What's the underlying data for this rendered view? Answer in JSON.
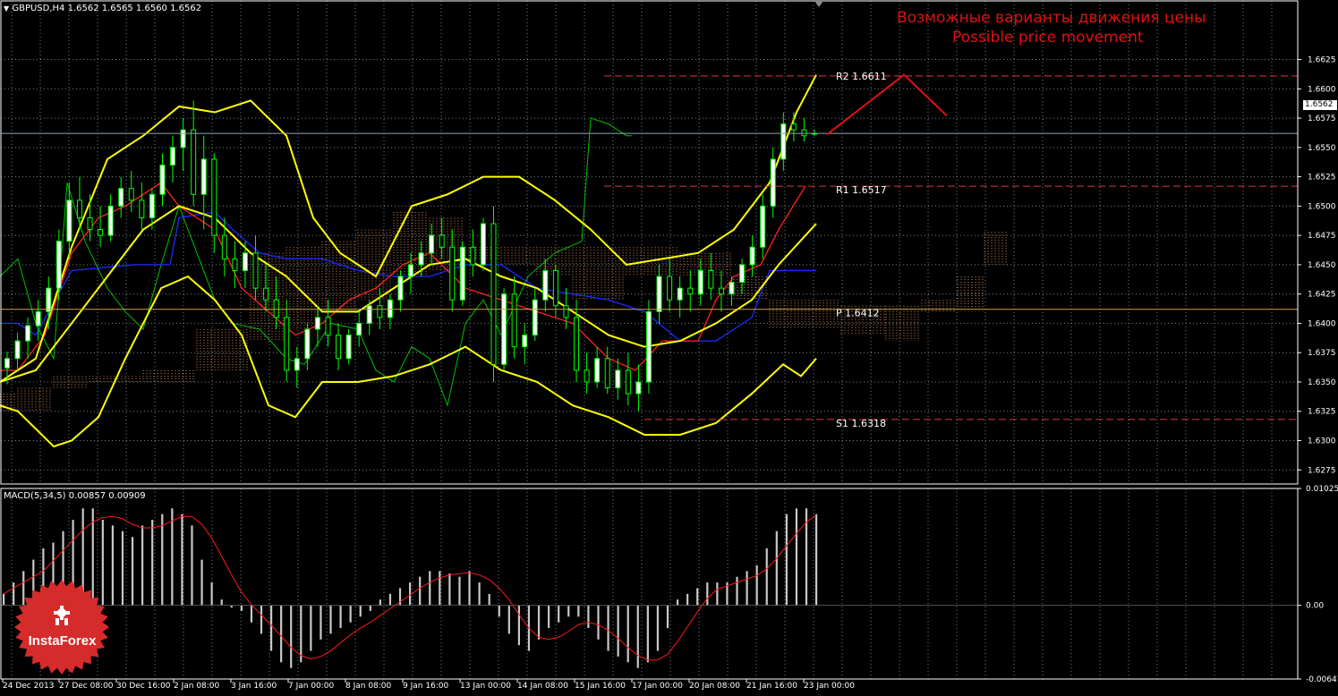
{
  "header": {
    "symbol_text": "GBPUSD,H4  1.6562 1.6565 1.6560 1.6562"
  },
  "annotation": {
    "line1": "Возможные варианты движения цены",
    "line2": "Possible price movement"
  },
  "price_tag": "1.6562",
  "levels": [
    {
      "name": "R2",
      "label": "R2  1.6611",
      "value": 1.6611
    },
    {
      "name": "R1",
      "label": "R1  1.6517",
      "value": 1.6517
    },
    {
      "name": "P",
      "label": "P  1.6412",
      "value": 1.6412
    },
    {
      "name": "S1",
      "label": "S1  1.6318",
      "value": 1.6318
    }
  ],
  "macd_label": "MACD(5,34,5) 0.00857 0.00909",
  "logo_text": "InstaForex",
  "colors": {
    "grid": "#6e7f8f",
    "frame": "#ffffff",
    "bollinger": "#ffff00",
    "ma_red": "#ff2222",
    "ma_blue": "#1a2cff",
    "green": "#00c000",
    "candle_body": "#ffffff",
    "candle_edge": "#00ff00",
    "cloud": "#d88b5a",
    "level_dash": "#d83a3a",
    "arrow": "#e01010",
    "annotation": "#e01010",
    "pivot_line": "#c9a34a",
    "macd_hist": "#c8c8c8",
    "macd_signal": "#ff1a1a",
    "logo": "#d62b2b"
  },
  "chart_data": {
    "type": "candlestick",
    "symbol": "GBPUSD",
    "timeframe": "H4",
    "ohlc_last": {
      "open": 1.6562,
      "high": 1.6565,
      "low": 1.656,
      "close": 1.6562
    },
    "current_price": 1.6562,
    "price_axis": {
      "ylim": [
        1.6263,
        1.6675
      ],
      "ticks": [
        "1.6625",
        "1.6600",
        "1.6575",
        "1.6550",
        "1.6525",
        "1.6500",
        "1.6475",
        "1.6450",
        "1.6425",
        "1.6400",
        "1.6375",
        "1.6350",
        "1.6325",
        "1.6300",
        "1.6275"
      ]
    },
    "time_axis": {
      "ticks": [
        "24 Dec 2013",
        "27 Dec 08:00",
        "30 Dec 16:00",
        "2 Jan 08:00",
        "3 Jan 16:00",
        "7 Jan 00:00",
        "8 Jan 08:00",
        "9 Jan 16:00",
        "13 Jan 00:00",
        "14 Jan 08:00",
        "15 Jan 16:00",
        "17 Jan 00:00",
        "20 Jan 08:00",
        "21 Jan 16:00",
        "23 Jan 00:00"
      ]
    },
    "pivot_levels": {
      "R2": 1.6611,
      "R1": 1.6517,
      "P": 1.6412,
      "S1": 1.6318
    },
    "candles": [
      [
        1.6362,
        1.6376,
        1.6348,
        1.637
      ],
      [
        1.637,
        1.6392,
        1.636,
        1.6385
      ],
      [
        1.6385,
        1.6405,
        1.637,
        1.6398
      ],
      [
        1.6398,
        1.642,
        1.6385,
        1.641
      ],
      [
        1.641,
        1.644,
        1.6395,
        1.643
      ],
      [
        1.643,
        1.648,
        1.642,
        1.647
      ],
      [
        1.647,
        1.652,
        1.6455,
        1.6505
      ],
      [
        1.6505,
        1.6525,
        1.648,
        1.649
      ],
      [
        1.649,
        1.651,
        1.647,
        1.648
      ],
      [
        1.648,
        1.65,
        1.6465,
        1.6475
      ],
      [
        1.6475,
        1.651,
        1.647,
        1.65
      ],
      [
        1.65,
        1.6525,
        1.649,
        1.6515
      ],
      [
        1.6515,
        1.653,
        1.6495,
        1.6505
      ],
      [
        1.6505,
        1.652,
        1.648,
        1.649
      ],
      [
        1.649,
        1.6515,
        1.648,
        1.651
      ],
      [
        1.651,
        1.6545,
        1.65,
        1.6535
      ],
      [
        1.6535,
        1.656,
        1.652,
        1.655
      ],
      [
        1.655,
        1.6575,
        1.653,
        1.6565
      ],
      [
        1.6565,
        1.659,
        1.65,
        1.651
      ],
      [
        1.651,
        1.656,
        1.648,
        1.654
      ],
      [
        1.654,
        1.6545,
        1.646,
        1.6475
      ],
      [
        1.6475,
        1.649,
        1.644,
        1.6455
      ],
      [
        1.6455,
        1.647,
        1.643,
        1.6445
      ],
      [
        1.6445,
        1.647,
        1.643,
        1.646
      ],
      [
        1.646,
        1.6475,
        1.642,
        1.643
      ],
      [
        1.643,
        1.645,
        1.641,
        1.642
      ],
      [
        1.642,
        1.644,
        1.6395,
        1.6405
      ],
      [
        1.6405,
        1.642,
        1.635,
        1.636
      ],
      [
        1.636,
        1.638,
        1.6345,
        1.637
      ],
      [
        1.637,
        1.64,
        1.636,
        1.6395
      ],
      [
        1.6395,
        1.6415,
        1.638,
        1.6405
      ],
      [
        1.6405,
        1.642,
        1.638,
        1.639
      ],
      [
        1.639,
        1.64,
        1.636,
        1.637
      ],
      [
        1.637,
        1.6395,
        1.6365,
        1.639
      ],
      [
        1.639,
        1.641,
        1.638,
        1.64
      ],
      [
        1.64,
        1.642,
        1.639,
        1.6415
      ],
      [
        1.6415,
        1.643,
        1.6395,
        1.6405
      ],
      [
        1.6405,
        1.6425,
        1.6395,
        1.642
      ],
      [
        1.642,
        1.6445,
        1.641,
        1.644
      ],
      [
        1.644,
        1.646,
        1.6425,
        1.645
      ],
      [
        1.645,
        1.647,
        1.644,
        1.646
      ],
      [
        1.646,
        1.6485,
        1.645,
        1.6475
      ],
      [
        1.6475,
        1.649,
        1.6455,
        1.6465
      ],
      [
        1.6465,
        1.648,
        1.641,
        1.642
      ],
      [
        1.642,
        1.647,
        1.6415,
        1.6465
      ],
      [
        1.6465,
        1.648,
        1.644,
        1.645
      ],
      [
        1.645,
        1.649,
        1.6445,
        1.6485
      ],
      [
        1.6485,
        1.65,
        1.635,
        1.6365
      ],
      [
        1.6365,
        1.643,
        1.636,
        1.6425
      ],
      [
        1.6425,
        1.644,
        1.637,
        1.638
      ],
      [
        1.638,
        1.64,
        1.6365,
        1.639
      ],
      [
        1.639,
        1.643,
        1.6385,
        1.642
      ],
      [
        1.642,
        1.6455,
        1.641,
        1.6445
      ],
      [
        1.6445,
        1.645,
        1.6405,
        1.6415
      ],
      [
        1.6415,
        1.643,
        1.6395,
        1.6405
      ],
      [
        1.6405,
        1.642,
        1.635,
        1.636
      ],
      [
        1.636,
        1.6375,
        1.634,
        1.635
      ],
      [
        1.635,
        1.638,
        1.6345,
        1.637
      ],
      [
        1.637,
        1.638,
        1.634,
        1.6345
      ],
      [
        1.6345,
        1.637,
        1.6335,
        1.636
      ],
      [
        1.636,
        1.6375,
        1.633,
        1.634
      ],
      [
        1.634,
        1.6365,
        1.6325,
        1.635
      ],
      [
        1.635,
        1.642,
        1.634,
        1.641
      ],
      [
        1.641,
        1.645,
        1.64,
        1.644
      ],
      [
        1.644,
        1.6455,
        1.641,
        1.642
      ],
      [
        1.642,
        1.644,
        1.6405,
        1.643
      ],
      [
        1.643,
        1.6445,
        1.641,
        1.6425
      ],
      [
        1.6425,
        1.6455,
        1.6415,
        1.6445
      ],
      [
        1.6445,
        1.646,
        1.642,
        1.643
      ],
      [
        1.643,
        1.6445,
        1.641,
        1.6425
      ],
      [
        1.6425,
        1.644,
        1.6415,
        1.6435
      ],
      [
        1.6435,
        1.6455,
        1.6425,
        1.645
      ],
      [
        1.645,
        1.6475,
        1.644,
        1.6465
      ],
      [
        1.6465,
        1.651,
        1.6455,
        1.65
      ],
      [
        1.65,
        1.655,
        1.649,
        1.654
      ],
      [
        1.654,
        1.658,
        1.653,
        1.657
      ],
      [
        1.657,
        1.658,
        1.6555,
        1.6565
      ],
      [
        1.6565,
        1.6575,
        1.6555,
        1.656
      ],
      [
        1.6562,
        1.6565,
        1.656,
        1.6562
      ]
    ],
    "macd": {
      "params": "5,34,5",
      "main_last": 0.00857,
      "signal_last": 0.00909,
      "ylim": [
        -0.00647,
        0.01025
      ],
      "ticks": [
        "0.01025",
        "0.00",
        "-0.00647"
      ]
    }
  }
}
